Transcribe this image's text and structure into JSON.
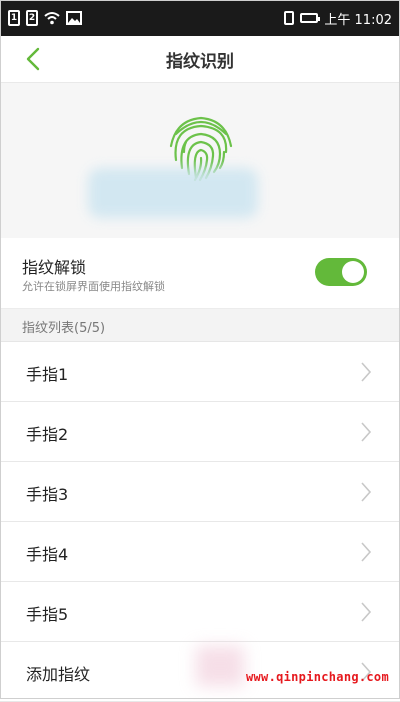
{
  "status_bar": {
    "sim1": "1",
    "sim2": "2",
    "time": "上午 11:02"
  },
  "header": {
    "title": "指纹识别"
  },
  "unlock_toggle": {
    "title": "指纹解锁",
    "subtitle": "允许在锁屏界面使用指纹解锁",
    "enabled": true
  },
  "fingerprint_list": {
    "header": "指纹列表(5/5)",
    "items": [
      {
        "label": "手指1"
      },
      {
        "label": "手指2"
      },
      {
        "label": "手指3"
      },
      {
        "label": "手指4"
      },
      {
        "label": "手指5"
      },
      {
        "label": "添加指纹"
      }
    ]
  },
  "watermark": "www.qinpinchang.com",
  "colors": {
    "accent": "#63b93a",
    "status_bar": "#1a1a1a",
    "watermark": "#e6191e"
  }
}
